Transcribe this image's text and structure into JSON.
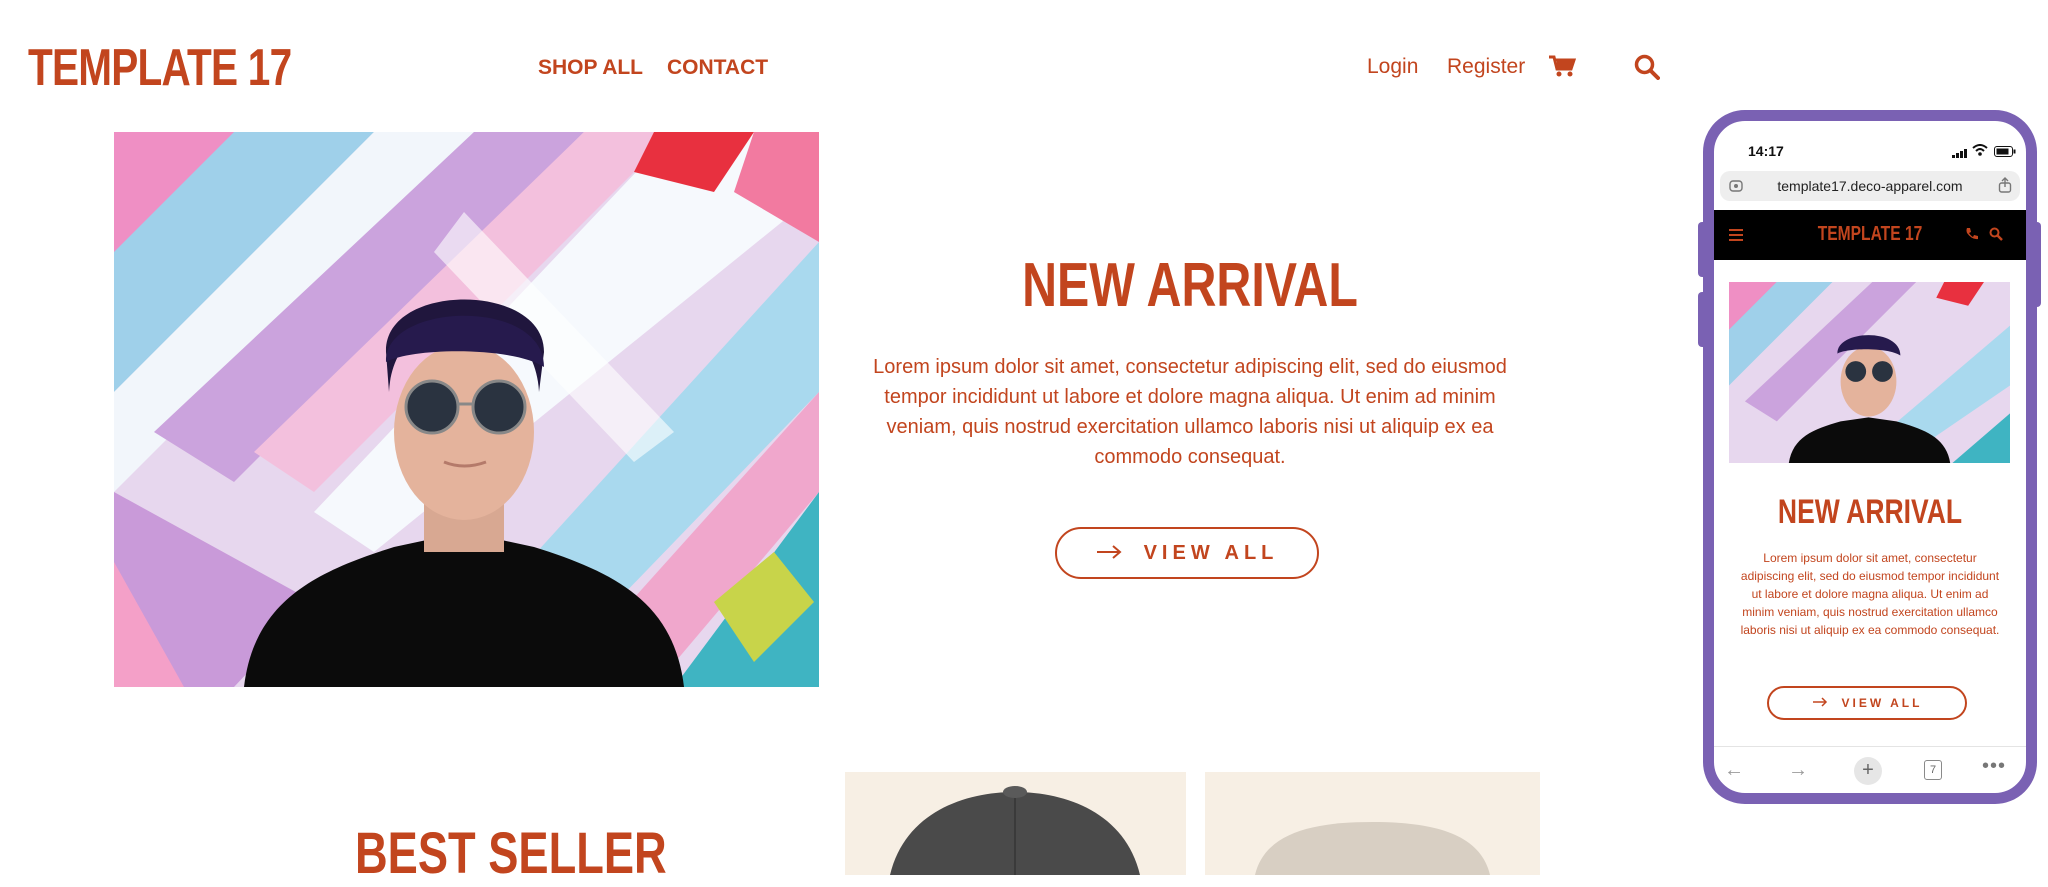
{
  "header": {
    "logo": "TEMPLATE 17",
    "nav": [
      "SHOP ALL",
      "CONTACT"
    ],
    "login": "Login",
    "register": "Register"
  },
  "icons": {
    "cart": "cart-icon",
    "search": "search-icon",
    "arrow": "arrow-right-icon"
  },
  "hero": {
    "title": "NEW ARRIVAL",
    "text": "Lorem ipsum dolor sit amet, consectetur adipiscing elit, sed do eiusmod tempor incididunt ut labore et dolore magna aliqua. Ut enim ad minim veniam, quis nostrud exercitation ullamco laboris nisi ut aliquip ex ea commodo consequat.",
    "button": "VIEW ALL"
  },
  "best_seller": {
    "title": "BEST SELLER"
  },
  "phone": {
    "time": "14:17",
    "url": "template17.deco-apparel.com",
    "logo": "TEMPLATE 17",
    "title": "NEW ARRIVAL",
    "text": "Lorem ipsum dolor sit amet, consectetur adipiscing elit, sed do eiusmod tempor incididunt ut labore et dolore magna aliqua. Ut enim ad minim veniam, quis nostrud exercitation ullamco laboris nisi ut aliquip ex ea commodo consequat.",
    "button": "VIEW ALL",
    "tab_count": "7"
  },
  "colors": {
    "brand": "#c2451e",
    "phone_frame": "#7a61b3",
    "product_bg": "#f7efe4"
  }
}
